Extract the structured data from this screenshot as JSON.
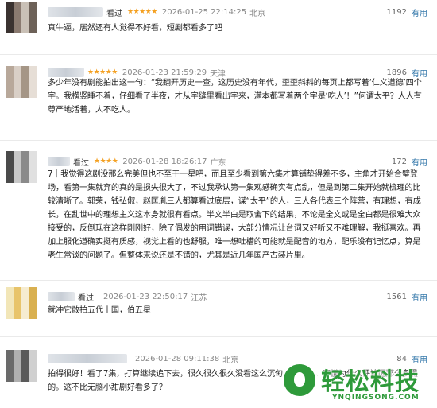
{
  "reviews": [
    {
      "username": "看过",
      "stars": "★★★★★",
      "time": "2026-01-25 22:14:25",
      "location": "北京",
      "votes": "1192",
      "useful_label": "有用",
      "content": "真牛逼，居然还有人觉得不好看，短剧都看多了吧",
      "avatar_colors": [
        "#3a3230",
        "#8a7a70",
        "#c9c0b6",
        "#6d6158"
      ]
    },
    {
      "username": "",
      "stars": "★★★★★",
      "time": "2026-01-23 21:59:29",
      "location": "天津",
      "votes": "1896",
      "useful_label": "有用",
      "content": "多少年没有剧能拍出这一句：“我翻开历史一查，这历史没有年代，歪歪斜斜的每页上都写着‘仁义道德’四个字。我横竖睡不着，仔细看了半夜，才从字缝里看出字来，满本都写着两个字是‘吃人’！”何谓太平？人人有尊严地活着，人不吃人。",
      "avatar_colors": [
        "#b8a89a",
        "#d9cfc6",
        "#a59686",
        "#e6ded6"
      ]
    },
    {
      "username": "看过",
      "stars": "★★★★",
      "time": "2026-01-28 18:26:17",
      "location": "广东",
      "votes": "172",
      "useful_label": "有用",
      "content": "7｜我觉得这剧没那么完美但也不至于一星吧，而且至少看到第六集才算铺垫得差不多，主角才开始合璧登场，看第一集就弃的真的是损失很大了，不过我承认第一集观感确实有点乱，但是到第二集开始就梳理的比较清晰了。郭荣，钱弘俶，赵匡胤三人都算看过底层，谋“太平”的人，三人各代表三个阵营，有理想，有成长，在乱世中的理想主义这本身就很有看点。半文半白是取舍下的结果，不论是全文或是全白都是很难大众接受的，反倒现在这样刚刚好，除了偶发的用词错误，大部分情况让台词又好听又不难理解，我挺喜欢。再加上服化道确实挺有质感，视觉上看的也舒服，唯一想吐槽的可能就是配音的地方，配乐没有记忆点，算是老生常谈的问题了。但整体来说还是不错的，尤其是近几年国产古装片里。",
      "avatar_colors": [
        "#4a4a4a",
        "#c8c8c8",
        "#8a8a8a",
        "#e0e0e0"
      ]
    },
    {
      "username": "看过",
      "stars": "",
      "time": "2026-01-23 22:50:17",
      "location": "江苏",
      "votes": "1561",
      "useful_label": "有用",
      "content": "就冲它敢拍五代十国，伯五星",
      "avatar_colors": [
        "#f2e6b8",
        "#e8c46a",
        "#f6ecd0",
        "#d9b050"
      ]
    },
    {
      "username": "",
      "stars": "",
      "time": "2026-01-28 09:11:38",
      "location": "北京",
      "votes": "84",
      "useful_label": "有用",
      "content": "拍得很好！看了7集，打算继续追下去，很久很久很久没看这么沉甸甸的剧了。不懂为什么评论区那么多黑的。这不比无脑小甜剧好看多了？",
      "avatar_colors": [
        "#6a6a6a",
        "#b0b0b0",
        "#5a5a5a",
        "#d0d0d0"
      ]
    }
  ],
  "watermark": {
    "title": "轻松科技",
    "subtitle": "YNQINGSONG.COM"
  }
}
